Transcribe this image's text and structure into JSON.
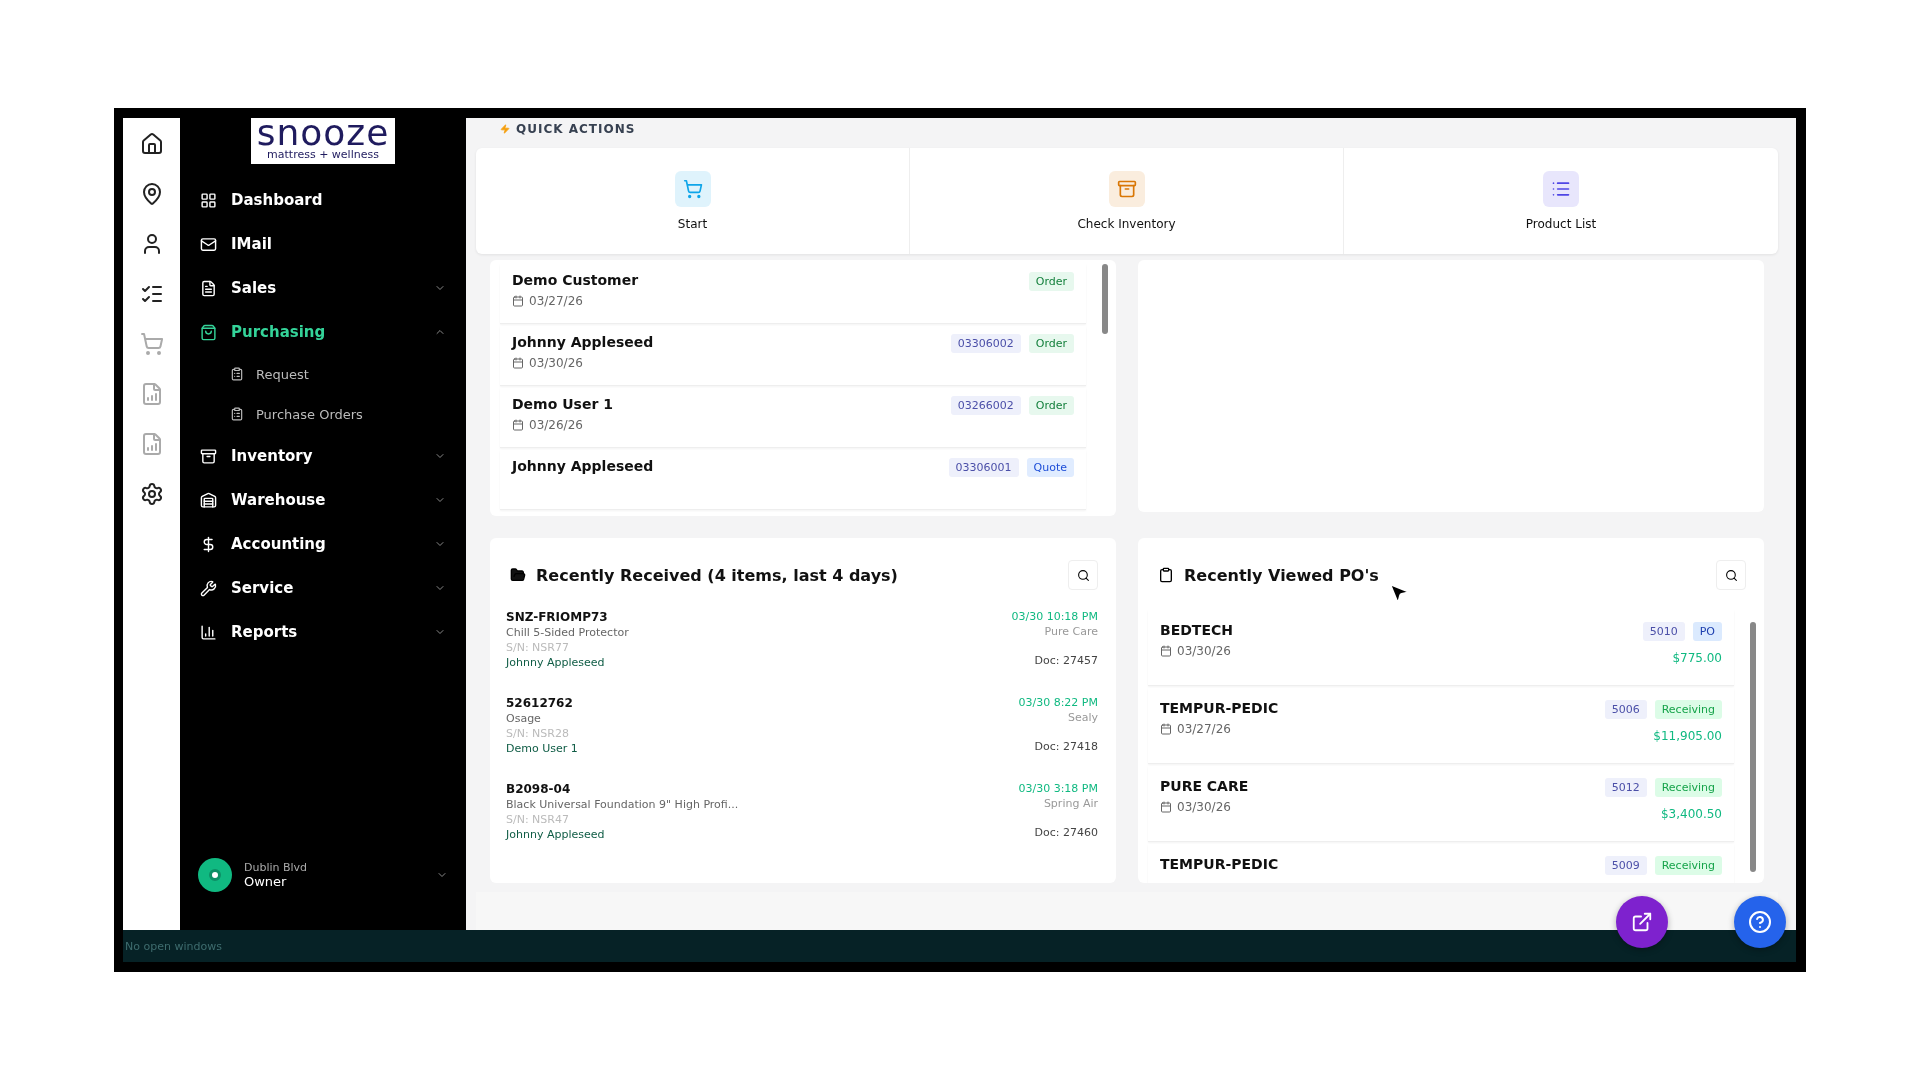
{
  "brand": {
    "name": "snooze",
    "tagline": "mattress + wellness"
  },
  "sidebar": {
    "items": [
      {
        "label": "Dashboard",
        "selected": false
      },
      {
        "label": "IMail",
        "selected": false
      },
      {
        "label": "Sales",
        "selected": false,
        "expanded": false
      },
      {
        "label": "Purchasing",
        "selected": true,
        "expanded": true,
        "children": [
          {
            "label": "Request"
          },
          {
            "label": "Purchase Orders"
          }
        ]
      },
      {
        "label": "Inventory",
        "selected": false,
        "expanded": false
      },
      {
        "label": "Warehouse",
        "selected": false,
        "expanded": false
      },
      {
        "label": "Accounting",
        "selected": false,
        "expanded": false
      },
      {
        "label": "Service",
        "selected": false,
        "expanded": false
      },
      {
        "label": "Reports",
        "selected": false,
        "expanded": false
      }
    ],
    "user": {
      "location": "Dublin Blvd",
      "role": "Owner"
    }
  },
  "quick_actions": {
    "title": "QUICK ACTIONS",
    "items": [
      {
        "label": "Start",
        "color": "#0ea5e9"
      },
      {
        "label": "Check Inventory",
        "color": "#d97706"
      },
      {
        "label": "Product List",
        "color": "#4f46e5"
      }
    ]
  },
  "orders": [
    {
      "name": "Demo Customer",
      "date": "03/27/26",
      "status": "Order",
      "kind": "order"
    },
    {
      "name": "Johnny Appleseed",
      "date": "03/30/26",
      "number": "03306002",
      "status": "Order",
      "kind": "order"
    },
    {
      "name": "Demo User 1",
      "date": "03/26/26",
      "number": "03266002",
      "status": "Order",
      "kind": "order"
    },
    {
      "name": "Johnny Appleseed",
      "number": "03306001",
      "status": "Quote",
      "kind": "quote"
    }
  ],
  "recently_received": {
    "title": "Recently Received (4 items, last 4 days)",
    "items": [
      {
        "sku": "SNZ-FRIOMP73",
        "description": "Chill 5-Sided Protector",
        "serial": "S/N: NSR77",
        "user": "Johnny Appleseed",
        "time": "03/30 10:18 PM",
        "vendor": "Pure Care",
        "doc": "Doc: 27457"
      },
      {
        "sku": "52612762",
        "description": "Osage",
        "serial": "S/N: NSR28",
        "user": "Demo User 1",
        "time": "03/30 8:22 PM",
        "vendor": "Sealy",
        "doc": "Doc: 27418"
      },
      {
        "sku": "B2098-04",
        "description": "Black Universal Foundation 9\" High Profi...",
        "serial": "S/N: NSR47",
        "user": "Johnny Appleseed",
        "time": "03/30 3:18 PM",
        "vendor": "Spring Air",
        "doc": "Doc: 27460"
      }
    ]
  },
  "recently_viewed": {
    "title": "Recently Viewed PO's",
    "items": [
      {
        "vendor": "BEDTECH",
        "date": "03/30/26",
        "number": "5010",
        "status": "PO",
        "kind": "po",
        "amount": "$775.00"
      },
      {
        "vendor": "TEMPUR-PEDIC",
        "date": "03/27/26",
        "number": "5006",
        "status": "Receiving",
        "kind": "receiving",
        "amount": "$11,905.00"
      },
      {
        "vendor": "PURE CARE",
        "date": "03/30/26",
        "number": "5012",
        "status": "Receiving",
        "kind": "receiving",
        "amount": "$3,400.50"
      },
      {
        "vendor": "TEMPUR-PEDIC",
        "number": "5009",
        "status": "Receiving",
        "kind": "receiving"
      }
    ]
  },
  "taskbar": {
    "text": "No open windows"
  }
}
